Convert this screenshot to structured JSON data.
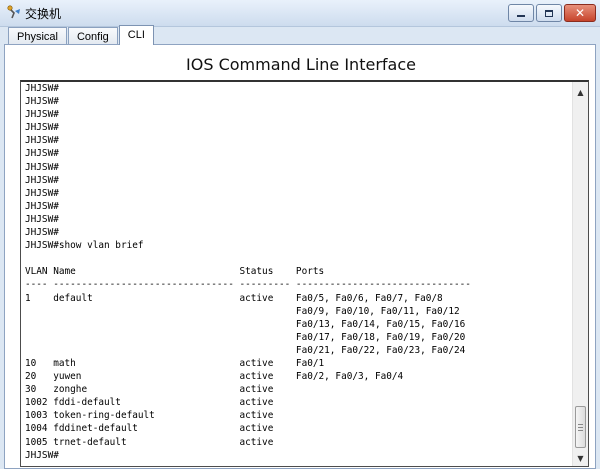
{
  "window": {
    "title": "交换机",
    "icon": "switch-icon",
    "buttons": {
      "minimize": "minimize-icon",
      "maximize": "maximize-icon",
      "close": "✕"
    }
  },
  "tabs": [
    {
      "label": "Physical",
      "active": false
    },
    {
      "label": "Config",
      "active": false
    },
    {
      "label": "CLI",
      "active": true
    }
  ],
  "cli": {
    "heading": "IOS Command Line Interface",
    "lines": [
      "JHJSW#",
      "JHJSW#",
      "JHJSW#",
      "JHJSW#",
      "JHJSW#",
      "JHJSW#",
      "JHJSW#",
      "JHJSW#",
      "JHJSW#",
      "JHJSW#",
      "JHJSW#",
      "JHJSW#",
      "JHJSW#show vlan brief",
      "",
      "VLAN Name                             Status    Ports",
      "---- -------------------------------- --------- -------------------------------",
      "1    default                          active    Fa0/5, Fa0/6, Fa0/7, Fa0/8",
      "                                                Fa0/9, Fa0/10, Fa0/11, Fa0/12",
      "                                                Fa0/13, Fa0/14, Fa0/15, Fa0/16",
      "                                                Fa0/17, Fa0/18, Fa0/19, Fa0/20",
      "                                                Fa0/21, Fa0/22, Fa0/23, Fa0/24",
      "10   math                             active    Fa0/1",
      "20   yuwen                            active    Fa0/2, Fa0/3, Fa0/4",
      "30   zonghe                           active",
      "1002 fddi-default                     active",
      "1003 token-ring-default               active",
      "1004 fddinet-default                  active",
      "1005 trnet-default                    active",
      "JHJSW#"
    ]
  },
  "scrollbar": {
    "up_icon": "▲",
    "down_icon": "▼",
    "position": 1.0
  }
}
